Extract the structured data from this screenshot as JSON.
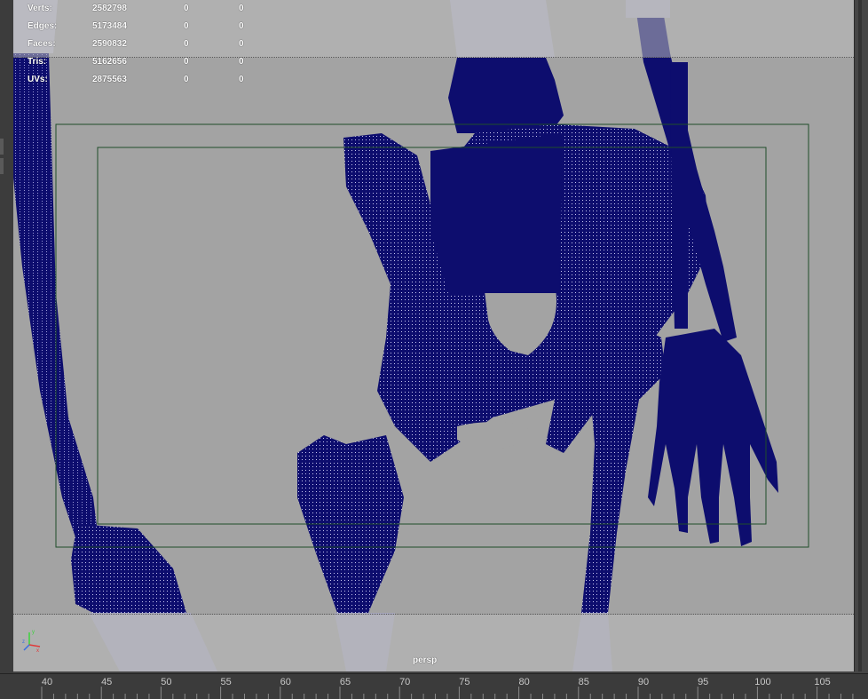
{
  "heads_up": {
    "stats": [
      {
        "label": "Verts:",
        "total": "2582798",
        "selected": "0",
        "components": "0"
      },
      {
        "label": "Edges:",
        "total": "5173484",
        "selected": "0",
        "components": "0"
      },
      {
        "label": "Faces:",
        "total": "2590832",
        "selected": "0",
        "components": "0"
      },
      {
        "label": "Tris:",
        "total": "5162656",
        "selected": "0",
        "components": "0"
      },
      {
        "label": "UVs:",
        "total": "2875563",
        "selected": "0",
        "components": "0"
      }
    ]
  },
  "viewport": {
    "camera_name": "persp",
    "wireframe_color": "#0d0d6e",
    "gate_color": "#1f4d2a",
    "background_color": "#a3a3a3"
  },
  "timeline": {
    "frames": [
      "40",
      "45",
      "50",
      "55",
      "60",
      "65",
      "70",
      "75",
      "80",
      "85",
      "90",
      "95",
      "100",
      "105"
    ]
  },
  "icons": {
    "axis_gizmo": "xyz-axis-icon"
  }
}
